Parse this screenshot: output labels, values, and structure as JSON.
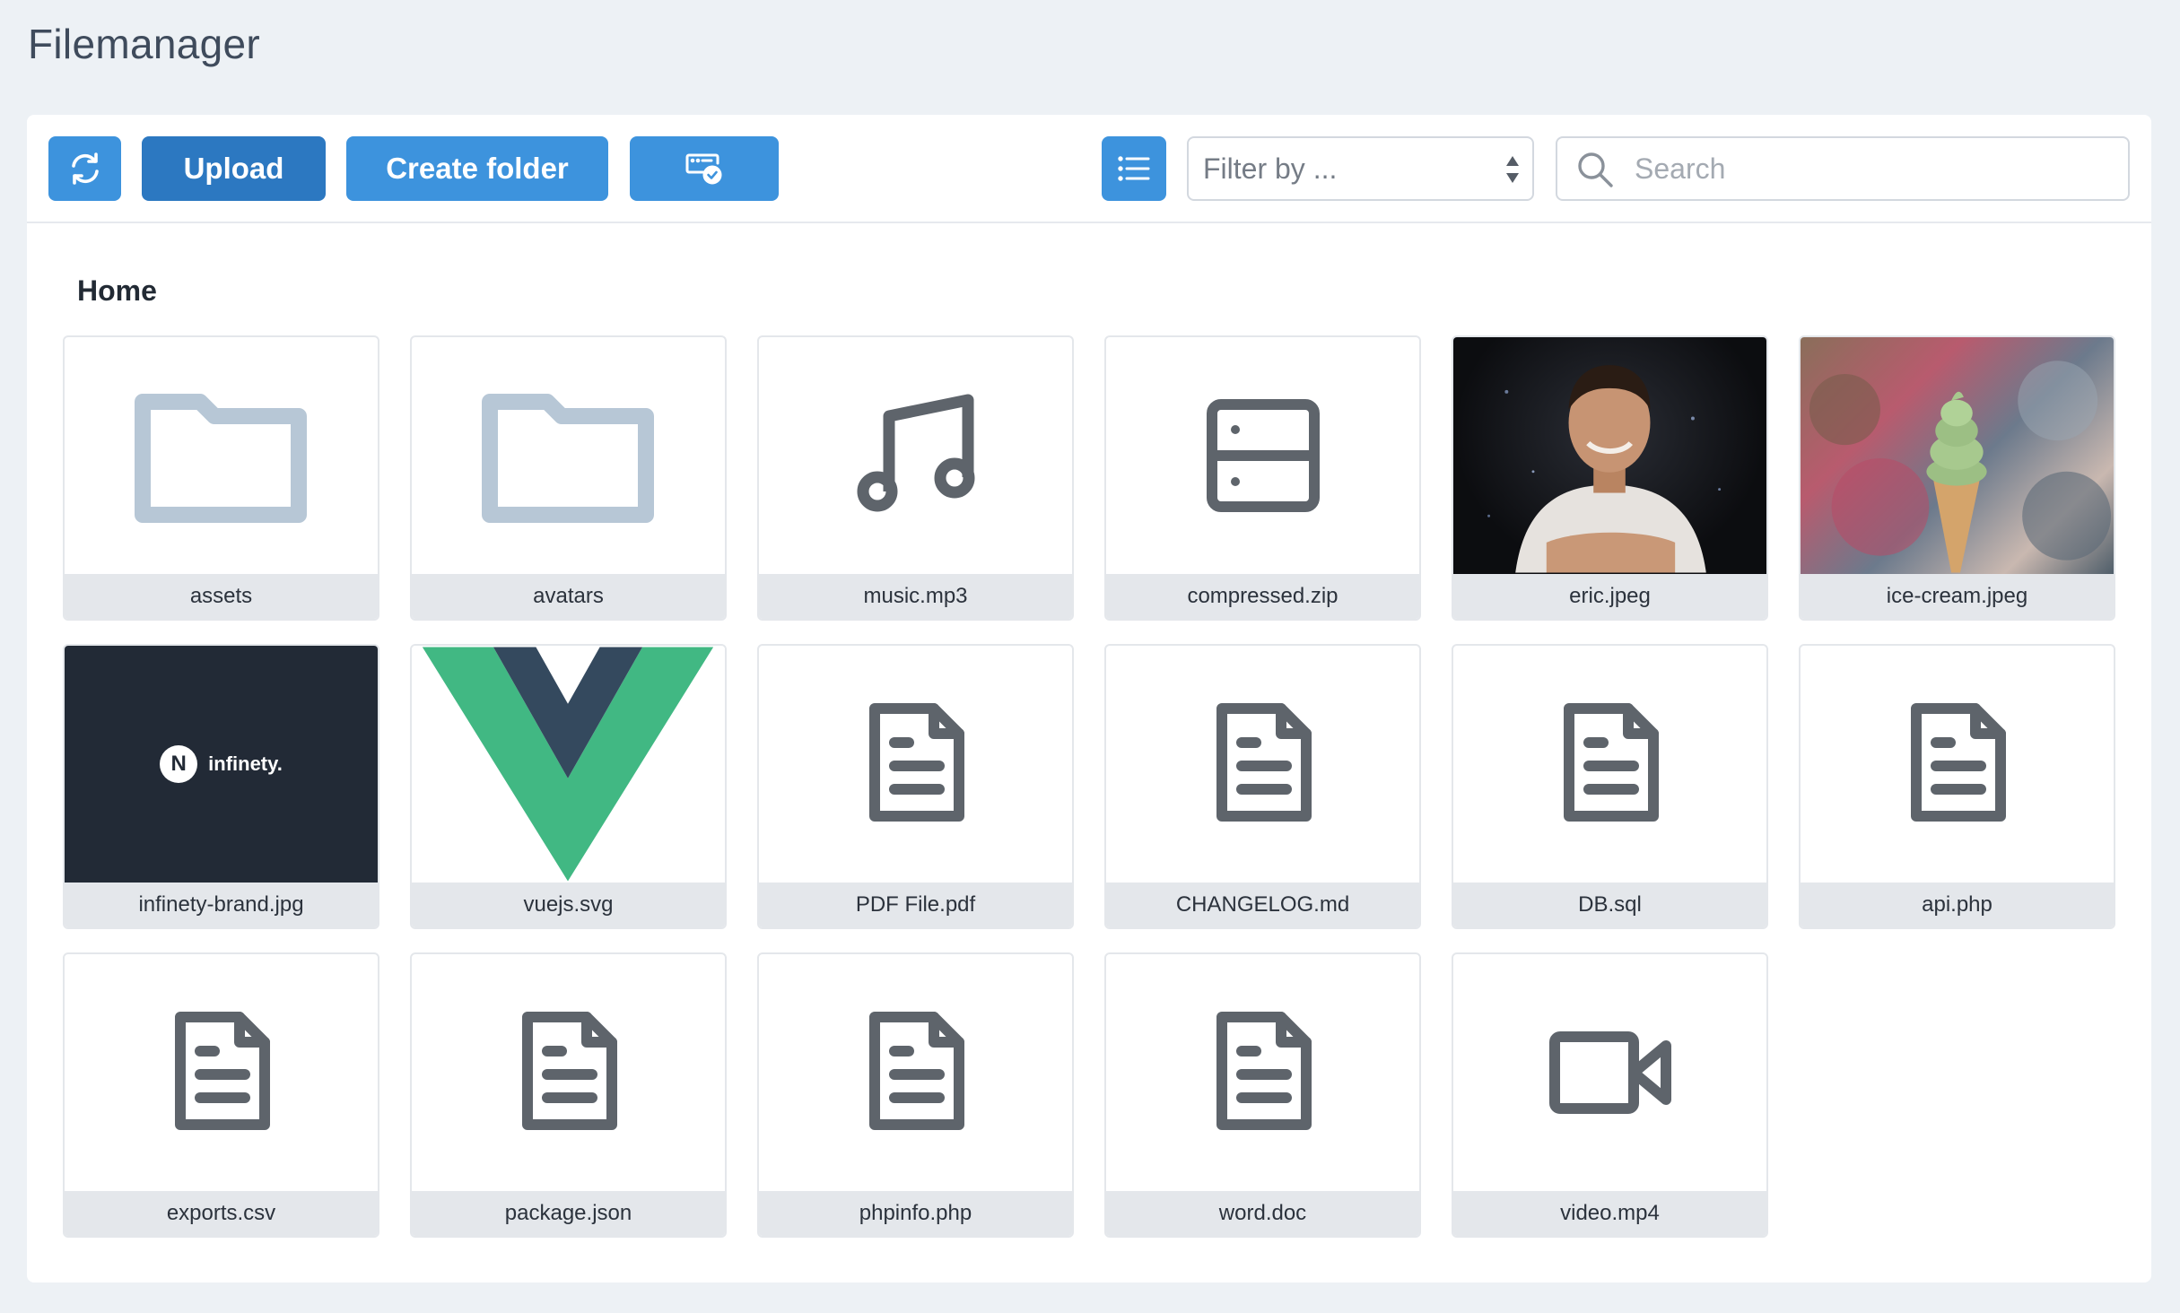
{
  "app": {
    "title": "Filemanager"
  },
  "toolbar": {
    "upload_label": "Upload",
    "create_folder_label": "Create folder",
    "filter_placeholder": "Filter by ...",
    "search_placeholder": "Search"
  },
  "breadcrumb": {
    "current": "Home"
  },
  "colors": {
    "primary": "#3d93dd",
    "primary_dark": "#2c78c1",
    "folder": "#b7c7d6",
    "file_icon": "#5e646b",
    "background": "#edf1f5"
  },
  "files": [
    {
      "name": "assets",
      "icon": "folder-icon"
    },
    {
      "name": "avatars",
      "icon": "folder-icon"
    },
    {
      "name": "music.mp3",
      "icon": "music-note-icon"
    },
    {
      "name": "compressed.zip",
      "icon": "archive-icon"
    },
    {
      "name": "eric.jpeg",
      "icon": "image-thumbnail"
    },
    {
      "name": "ice-cream.jpeg",
      "icon": "image-thumbnail"
    },
    {
      "name": "infinety-brand.jpg",
      "icon": "image-thumbnail",
      "brand_text": "infinety."
    },
    {
      "name": "vuejs.svg",
      "icon": "vue-logo"
    },
    {
      "name": "PDF File.pdf",
      "icon": "document-icon"
    },
    {
      "name": "CHANGELOG.md",
      "icon": "document-icon"
    },
    {
      "name": "DB.sql",
      "icon": "document-icon"
    },
    {
      "name": "api.php",
      "icon": "document-icon"
    },
    {
      "name": "exports.csv",
      "icon": "document-icon"
    },
    {
      "name": "package.json",
      "icon": "document-icon"
    },
    {
      "name": "phpinfo.php",
      "icon": "document-icon"
    },
    {
      "name": "word.doc",
      "icon": "document-icon"
    },
    {
      "name": "video.mp4",
      "icon": "video-camera-icon"
    }
  ]
}
